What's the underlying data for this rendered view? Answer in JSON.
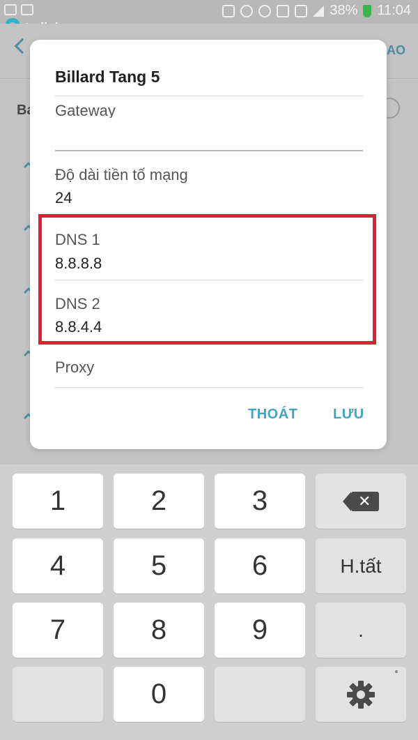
{
  "status_bar": {
    "battery": "38%",
    "time": "11:04"
  },
  "logo": {
    "text": "tp-link"
  },
  "background": {
    "action": "AO",
    "row_text": "Ba"
  },
  "dialog": {
    "title": "Billard Tang 5",
    "gateway_label": "Gateway",
    "prefix_label": "Độ dài tiền tố mạng",
    "prefix_value": "24",
    "dns1_label": "DNS 1",
    "dns1_value": "8.8.8.8",
    "dns2_label": "DNS 2",
    "dns2_value": "8.8.4.4",
    "proxy_label": "Proxy",
    "cancel_label": "THOÁT",
    "save_label": "LƯU"
  },
  "keyboard": {
    "keys": [
      "1",
      "2",
      "3",
      "4",
      "5",
      "6",
      "7",
      "8",
      "9",
      "0"
    ],
    "done_label": "H.tất",
    "dot_label": "."
  },
  "colors": {
    "accent": "#3ea6c0",
    "highlight": "#e0202e",
    "logo": "#2bb3c9"
  }
}
